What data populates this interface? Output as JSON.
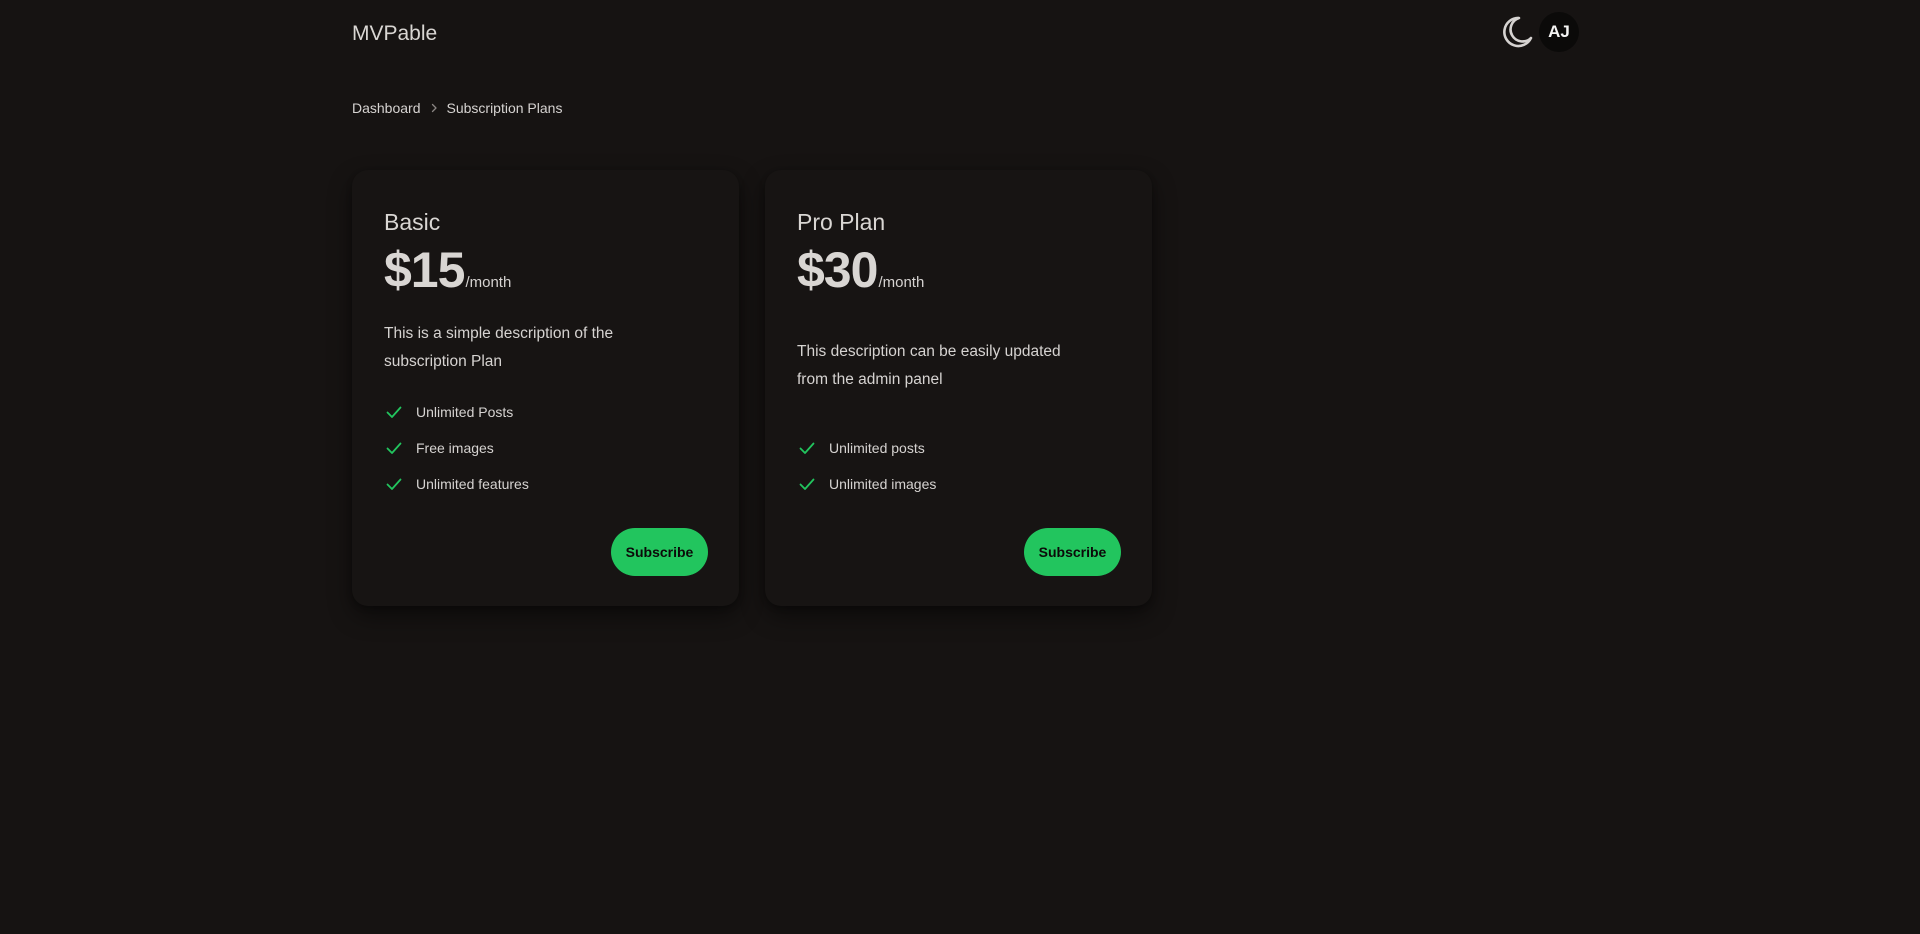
{
  "header": {
    "brand": "MVPable",
    "theme_toggle_icon": "moon-icon",
    "avatar_initials": "AJ"
  },
  "breadcrumb": {
    "items": [
      "Dashboard",
      "Subscription Plans"
    ],
    "separator_icon": "chevron-right-icon"
  },
  "plans": [
    {
      "name": "Basic",
      "price": "$15",
      "period": "/month",
      "description": "This is a simple description of the subscription Plan",
      "features": [
        "Unlimited Posts",
        "Free images",
        "Unlimited features"
      ],
      "button_label": "Subscribe"
    },
    {
      "name": "Pro Plan",
      "price": "$30",
      "period": "/month",
      "description": "This description can be easily updated from the admin panel",
      "features": [
        "Unlimited posts",
        "Unlimited images"
      ],
      "button_label": "Subscribe"
    }
  ],
  "colors": {
    "background": "#161312",
    "accent": "#22c55e",
    "text": "#d6d3d1",
    "check": "#22c55e"
  }
}
